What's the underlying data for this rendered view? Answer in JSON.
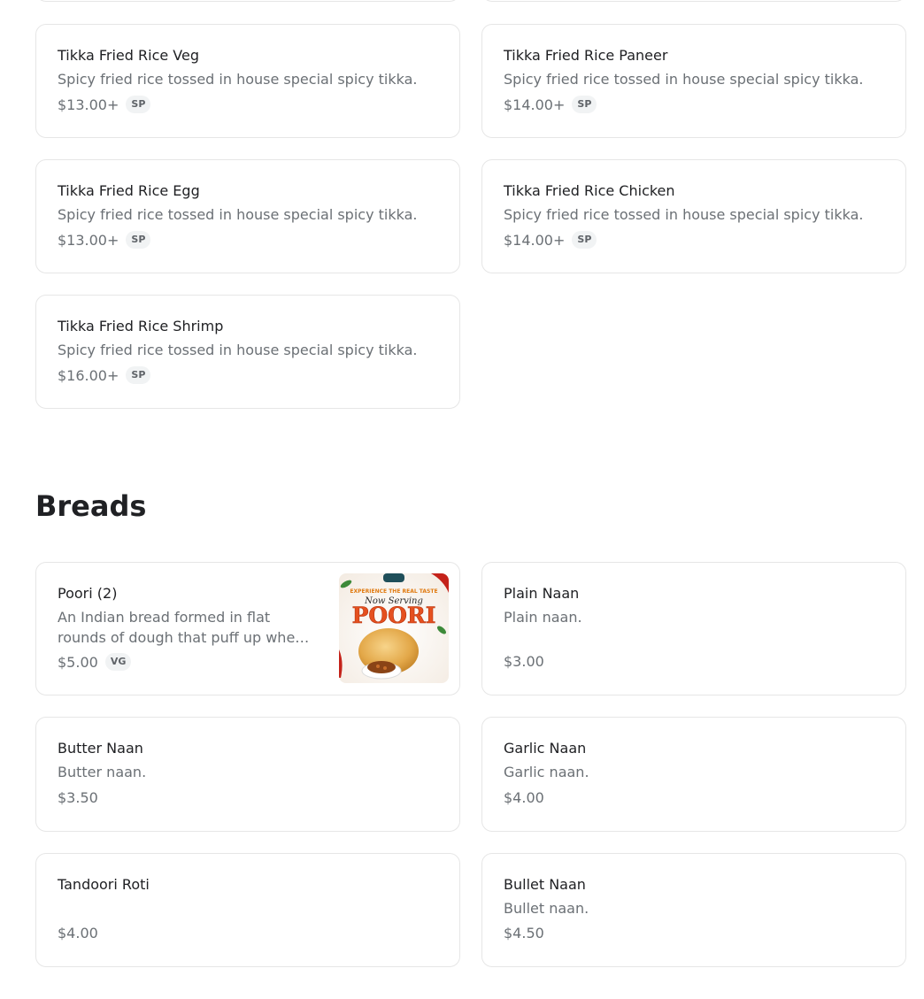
{
  "rice_items": [
    {
      "name": "Tikka Fried Rice Veg",
      "description": "Spicy fried rice tossed in house special spicy tikka.",
      "price": "$13.00+",
      "tag": "SP"
    },
    {
      "name": "Tikka Fried Rice Paneer",
      "description": "Spicy fried rice tossed in house special spicy tikka.",
      "price": "$14.00+",
      "tag": "SP"
    },
    {
      "name": "Tikka Fried Rice Egg",
      "description": "Spicy fried rice tossed in house special spicy tikka.",
      "price": "$13.00+",
      "tag": "SP"
    },
    {
      "name": "Tikka Fried Rice Chicken",
      "description": "Spicy fried rice tossed in house special spicy tikka.",
      "price": "$14.00+",
      "tag": "SP"
    },
    {
      "name": "Tikka Fried Rice Shrimp",
      "description": "Spicy fried rice tossed in house special spicy tikka.",
      "price": "$16.00+",
      "tag": "SP"
    }
  ],
  "breads": {
    "title": "Breads",
    "items": [
      {
        "name": "Poori (2)",
        "description": "An Indian bread formed in flat rounds of dough that puff up when fried.",
        "price": "$5.00",
        "tag": "VG",
        "image_text": {
          "top": "EXPERIENCE THE REAL TASTE",
          "script": "Now Serving",
          "big": "POORI"
        }
      },
      {
        "name": "Plain Naan",
        "description": "Plain naan.",
        "price": "$3.00"
      },
      {
        "name": "Butter Naan",
        "description": "Butter naan.",
        "price": "$3.50"
      },
      {
        "name": "Garlic Naan",
        "description": "Garlic naan.",
        "price": "$4.00"
      },
      {
        "name": "Tandoori Roti",
        "description": "",
        "price": "$4.00"
      },
      {
        "name": "Bullet Naan",
        "description": "Bullet naan.",
        "price": "$4.50"
      }
    ]
  }
}
